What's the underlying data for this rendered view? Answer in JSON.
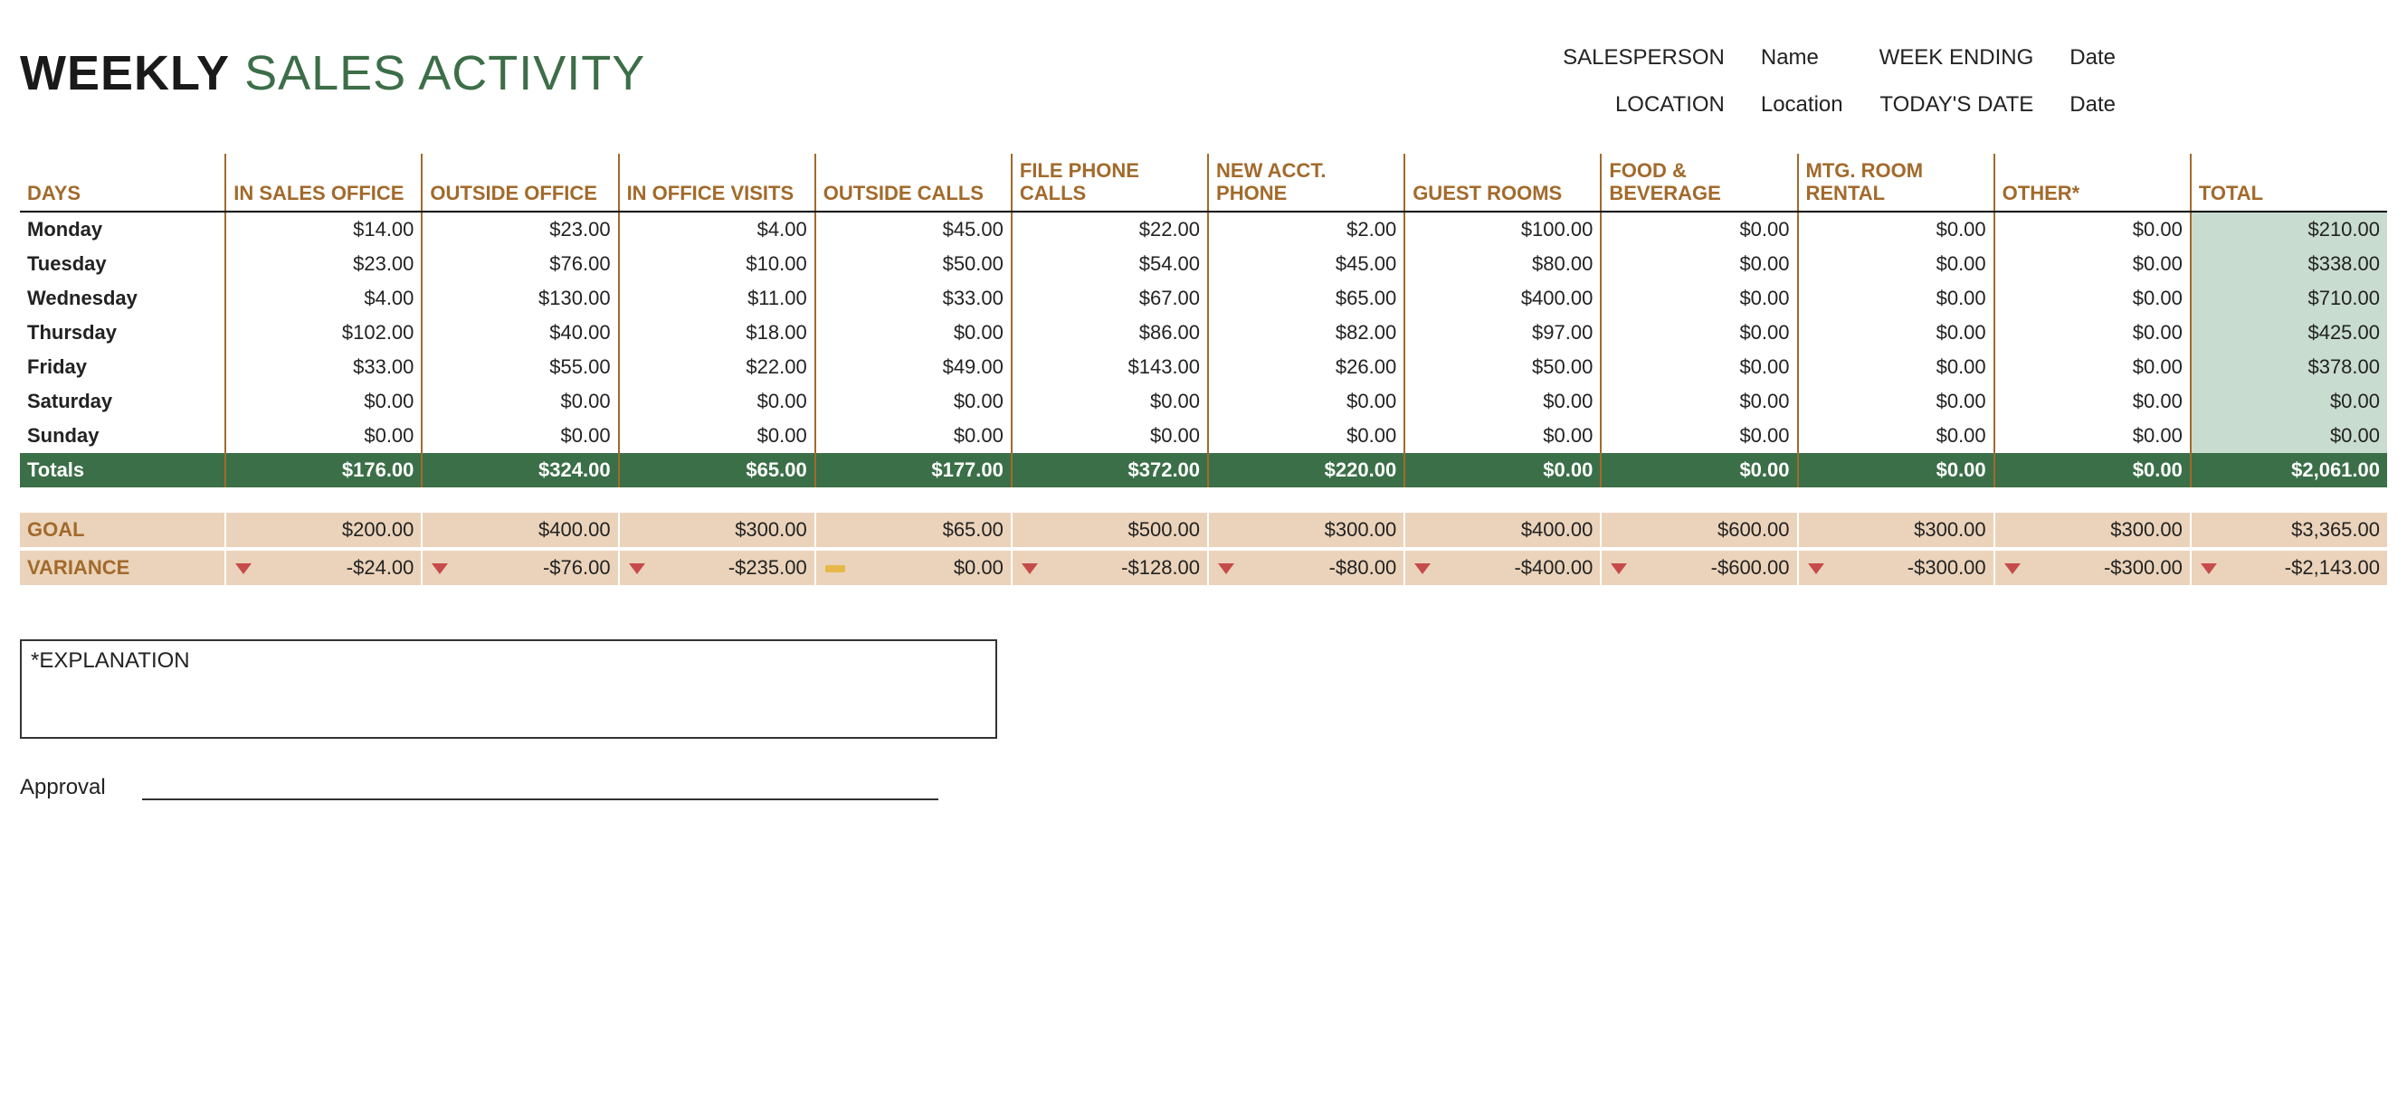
{
  "title": {
    "bold": "WEEKLY",
    "light": "SALES ACTIVITY"
  },
  "meta": {
    "salesperson_label": "SALESPERSON",
    "salesperson_value": "Name",
    "weekending_label": "WEEK ENDING",
    "weekending_value": "Date",
    "location_label": "LOCATION",
    "location_value": "Location",
    "today_label": "TODAY'S DATE",
    "today_value": "Date"
  },
  "headers": {
    "days": "DAYS",
    "cols": [
      "IN SALES OFFICE",
      "OUTSIDE OFFICE",
      "IN OFFICE VISITS",
      "OUTSIDE CALLS",
      "FILE PHONE CALLS",
      "NEW ACCT. PHONE",
      "GUEST ROOMS",
      "FOOD & BEVERAGE",
      "MTG. ROOM RENTAL",
      "OTHER*",
      "TOTAL"
    ]
  },
  "rows": [
    {
      "day": "Monday",
      "vals": [
        "$14.00",
        "$23.00",
        "$4.00",
        "$45.00",
        "$22.00",
        "$2.00",
        "$100.00",
        "$0.00",
        "$0.00",
        "$0.00"
      ],
      "total": "$210.00"
    },
    {
      "day": "Tuesday",
      "vals": [
        "$23.00",
        "$76.00",
        "$10.00",
        "$50.00",
        "$54.00",
        "$45.00",
        "$80.00",
        "$0.00",
        "$0.00",
        "$0.00"
      ],
      "total": "$338.00"
    },
    {
      "day": "Wednesday",
      "vals": [
        "$4.00",
        "$130.00",
        "$11.00",
        "$33.00",
        "$67.00",
        "$65.00",
        "$400.00",
        "$0.00",
        "$0.00",
        "$0.00"
      ],
      "total": "$710.00"
    },
    {
      "day": "Thursday",
      "vals": [
        "$102.00",
        "$40.00",
        "$18.00",
        "$0.00",
        "$86.00",
        "$82.00",
        "$97.00",
        "$0.00",
        "$0.00",
        "$0.00"
      ],
      "total": "$425.00"
    },
    {
      "day": "Friday",
      "vals": [
        "$33.00",
        "$55.00",
        "$22.00",
        "$49.00",
        "$143.00",
        "$26.00",
        "$50.00",
        "$0.00",
        "$0.00",
        "$0.00"
      ],
      "total": "$378.00"
    },
    {
      "day": "Saturday",
      "vals": [
        "$0.00",
        "$0.00",
        "$0.00",
        "$0.00",
        "$0.00",
        "$0.00",
        "$0.00",
        "$0.00",
        "$0.00",
        "$0.00"
      ],
      "total": "$0.00"
    },
    {
      "day": "Sunday",
      "vals": [
        "$0.00",
        "$0.00",
        "$0.00",
        "$0.00",
        "$0.00",
        "$0.00",
        "$0.00",
        "$0.00",
        "$0.00",
        "$0.00"
      ],
      "total": "$0.00"
    }
  ],
  "totals": {
    "label": "Totals",
    "vals": [
      "$176.00",
      "$324.00",
      "$65.00",
      "$177.00",
      "$372.00",
      "$220.00",
      "$0.00",
      "$0.00",
      "$0.00",
      "$0.00"
    ],
    "total": "$2,061.00"
  },
  "goal": {
    "label": "GOAL",
    "vals": [
      "$200.00",
      "$400.00",
      "$300.00",
      "$65.00",
      "$500.00",
      "$300.00",
      "$400.00",
      "$600.00",
      "$300.00",
      "$300.00"
    ],
    "total": "$3,365.00"
  },
  "variance": {
    "label": "VARIANCE",
    "cells": [
      {
        "icon": "down",
        "val": "-$24.00"
      },
      {
        "icon": "down",
        "val": "-$76.00"
      },
      {
        "icon": "down",
        "val": "-$235.00"
      },
      {
        "icon": "flat",
        "val": "$0.00"
      },
      {
        "icon": "down",
        "val": "-$128.00"
      },
      {
        "icon": "down",
        "val": "-$80.00"
      },
      {
        "icon": "down",
        "val": "-$400.00"
      },
      {
        "icon": "down",
        "val": "-$600.00"
      },
      {
        "icon": "down",
        "val": "-$300.00"
      },
      {
        "icon": "down",
        "val": "-$300.00"
      }
    ],
    "total": {
      "icon": "down",
      "val": "-$2,143.00"
    }
  },
  "explanation_label": "*EXPLANATION",
  "approval_label": "Approval"
}
